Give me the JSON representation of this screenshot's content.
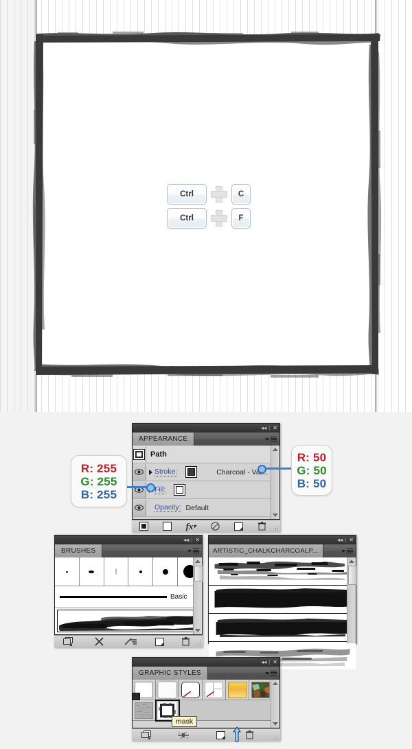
{
  "canvas": {
    "shortcuts": [
      {
        "key1": "Ctrl",
        "plus": "+",
        "key2": "C"
      },
      {
        "key1": "Ctrl",
        "plus": "+",
        "key2": "F"
      }
    ]
  },
  "callouts": {
    "white": {
      "r": "R: 255",
      "g": "G: 255",
      "b": "B: 255"
    },
    "gray": {
      "r": "R: 50",
      "g": "G: 50",
      "b": "B: 50"
    }
  },
  "appearance": {
    "tab_label": "APPEARANCE",
    "object_label": "Path",
    "rows": [
      {
        "label": "Stroke:",
        "value": "Charcoal - Var..."
      },
      {
        "label": "Fill:",
        "value": ""
      },
      {
        "label": "Opacity:",
        "value": "Default"
      }
    ],
    "footer_icons": [
      "add-new-stroke-icon",
      "add-new-fill-icon",
      "add-new-effect-icon",
      "clear-appearance-icon",
      "duplicate-item-icon",
      "delete-item-icon"
    ]
  },
  "brushes": {
    "tab_label": "BRUSHES",
    "basic_label": "Basic",
    "footer_icons": [
      "brush-libraries-menu-icon",
      "remove-brush-stroke-icon",
      "options-of-selected-object-icon",
      "new-brush-icon",
      "delete-brush-icon"
    ]
  },
  "library": {
    "tab_label": "ARTISTIC_CHALKCHARCOALP..."
  },
  "graphic_styles": {
    "tab_label": "GRAPHIC STYLES",
    "tooltip": "mask",
    "footer_icons": [
      "graphic-styles-libraries-menu-icon",
      "break-link-to-graphic-style-icon",
      "new-graphic-style-icon",
      "delete-graphic-style-icon"
    ]
  },
  "colors": {
    "accent_blue": "#3f7fd0",
    "callout_red": "#c0202a",
    "callout_green": "#2a8a2f",
    "callout_blue": "#2f62b0",
    "stroke_gray": "#323232",
    "fill_white": "#ffffff",
    "panel_bg": "#d4d4d4"
  }
}
